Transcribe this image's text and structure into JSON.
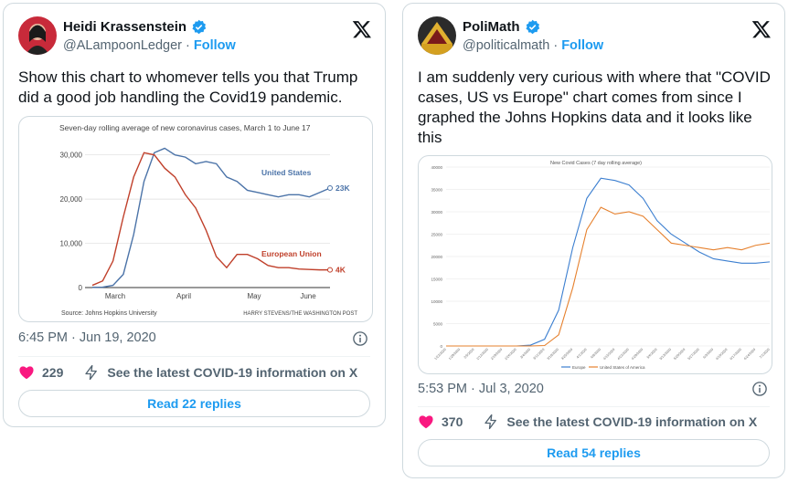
{
  "tweets": [
    {
      "name": "Heidi Krassenstein",
      "handle": "@ALampoonLedger",
      "separator": " · ",
      "follow": "Follow",
      "text": "Show this chart to whomever tells you that Trump did a good job handling the Covid19 pandemic.",
      "timestamp": "6:45 PM · Jun 19, 2020",
      "likes": "229",
      "covid_info": "See the latest COVID-19 information on X",
      "replies_button": "Read 22 replies"
    },
    {
      "name": "PoliMath",
      "handle": "@politicalmath",
      "separator": " · ",
      "follow": "Follow",
      "text": "I am suddenly very curious with where that \"COVID cases, US vs Europe\" chart comes from since I graphed the Johns Hopkins data and it looks like this",
      "timestamp": "5:53 PM · Jul 3, 2020",
      "likes": "370",
      "covid_info": "See the latest COVID-19 information on X",
      "replies_button": "Read 54 replies"
    }
  ],
  "colors": {
    "brand_blue": "#1d9bf0",
    "like_red": "#f91880",
    "us_blue": "#4b73a8",
    "eu_red": "#c0402b",
    "europe_blue": "#3c7fd0",
    "usa_orange": "#e6812e"
  },
  "icons": {
    "verified": "verified-badge-icon",
    "logo": "x-logo-icon",
    "like": "heart-icon",
    "info": "info-icon",
    "covid": "lightning-icon"
  },
  "chart_data": [
    {
      "type": "line",
      "title": "Seven-day rolling average of new coronavirus cases, March 1 to June 17",
      "categories": [
        "March",
        "April",
        "May",
        "June"
      ],
      "yticks": [
        "30,000",
        "20,000",
        "10,000",
        "0"
      ],
      "ylim": [
        0,
        32000
      ],
      "series": [
        {
          "name": "United States",
          "end_label": "23K",
          "values": [
            50,
            100,
            500,
            3000,
            12000,
            24000,
            30500,
            31500,
            30000,
            29500,
            28000,
            28500,
            28000,
            25000,
            24000,
            22000,
            21500,
            21000,
            20500,
            21000,
            21000,
            20500,
            21500,
            22500
          ]
        },
        {
          "name": "European Union",
          "end_label": "4K",
          "values": [
            500,
            1500,
            6000,
            16000,
            25000,
            30500,
            30000,
            27000,
            25000,
            21000,
            18000,
            13000,
            7000,
            4500,
            7500,
            7500,
            6500,
            5000,
            4500,
            4500,
            4200,
            4100,
            4000,
            4000
          ]
        }
      ],
      "source": "Source: Johns Hopkins University",
      "credit": "HARRY STEVENS/THE WASHINGTON POST"
    },
    {
      "type": "line",
      "title": "New Covid Cases (7 day rolling average)",
      "ylim": [
        0,
        40000
      ],
      "yticks": [
        "40000",
        "35000",
        "30000",
        "25000",
        "20000",
        "15000",
        "10000",
        "5000",
        "0"
      ],
      "xticks": [
        "1/22/2020",
        "1/29/2020",
        "2/5/2020",
        "2/12/2020",
        "2/19/2020",
        "2/26/2020",
        "3/4/2020",
        "3/11/2020",
        "3/18/2020",
        "3/25/2020",
        "4/1/2020",
        "4/8/2020",
        "4/15/2020",
        "4/22/2020",
        "4/29/2020",
        "5/6/2020",
        "5/13/2020",
        "5/20/2020",
        "5/27/2020",
        "6/3/2020",
        "6/10/2020",
        "6/17/2020",
        "6/24/2020",
        "7/1/2020"
      ],
      "series": [
        {
          "name": "Europe",
          "values": [
            0,
            0,
            0,
            0,
            0,
            0,
            200,
            1500,
            8000,
            22000,
            33000,
            37500,
            37000,
            36000,
            33000,
            28000,
            25000,
            23000,
            21000,
            19500,
            19000,
            18500,
            18500,
            18800
          ]
        },
        {
          "name": "United States of America",
          "values": [
            0,
            0,
            0,
            0,
            0,
            0,
            0,
            100,
            2500,
            13000,
            26000,
            31000,
            29500,
            30000,
            29000,
            26000,
            23000,
            22500,
            22000,
            21500,
            22000,
            21500,
            22500,
            23000
          ]
        }
      ]
    }
  ]
}
